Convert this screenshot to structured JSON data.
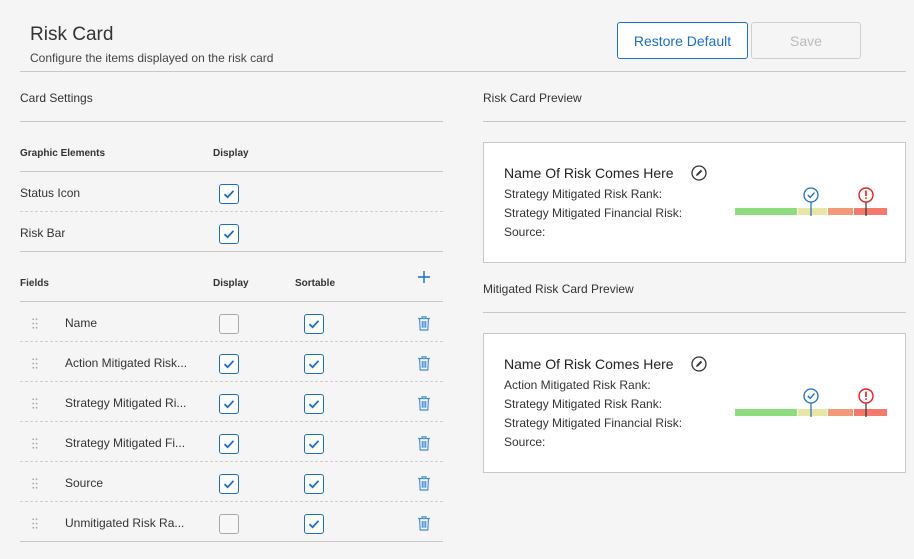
{
  "header": {
    "title": "Risk Card",
    "subtitle": "Configure the items displayed on the risk card",
    "restore_label": "Restore Default",
    "save_label": "Save"
  },
  "card_settings": {
    "title": "Card Settings",
    "graphic_header": "Graphic Elements",
    "display_header": "Display",
    "graphic_items": [
      {
        "label": "Status Icon",
        "display": true
      },
      {
        "label": "Risk Bar",
        "display": true
      }
    ],
    "fields_header": "Fields",
    "fields_display_header": "Display",
    "fields_sortable_header": "Sortable",
    "fields": [
      {
        "label": "Name",
        "display": false,
        "sortable": true
      },
      {
        "label": "Action Mitigated Risk...",
        "display": true,
        "sortable": true
      },
      {
        "label": "Strategy Mitigated Ri...",
        "display": true,
        "sortable": true
      },
      {
        "label": "Strategy Mitigated Fi...",
        "display": true,
        "sortable": true
      },
      {
        "label": "Source",
        "display": true,
        "sortable": true
      },
      {
        "label": "Unmitigated Risk Ra...",
        "display": false,
        "sortable": true
      }
    ]
  },
  "risk_card_preview": {
    "title": "Risk Card Preview",
    "name": "Name Of Risk Comes Here",
    "lines": [
      "Strategy Mitigated Risk Rank:",
      "Strategy Mitigated Financial Risk:",
      "Source:"
    ]
  },
  "mitigated_preview": {
    "title": "Mitigated Risk Card Preview",
    "name": "Name Of Risk Comes Here",
    "lines": [
      "Action Mitigated Risk Rank:",
      "Strategy Mitigated Risk Rank:",
      "Strategy Mitigated Financial Risk:",
      "Source:"
    ]
  },
  "colors": {
    "accent": "#1b6ec2",
    "bar_green": "#8fdc7c",
    "bar_yellow": "#e8e6a6",
    "bar_orange": "#f29a76",
    "bar_red": "#f27a6a",
    "alert_red": "#e02020"
  },
  "icons": {
    "edit": "pencil-circle-icon",
    "check_marker": "check-circle-icon",
    "alert_marker": "exclamation-circle-icon",
    "grip": "drag-handle-icon",
    "delete": "trash-icon",
    "add": "plus-icon"
  }
}
